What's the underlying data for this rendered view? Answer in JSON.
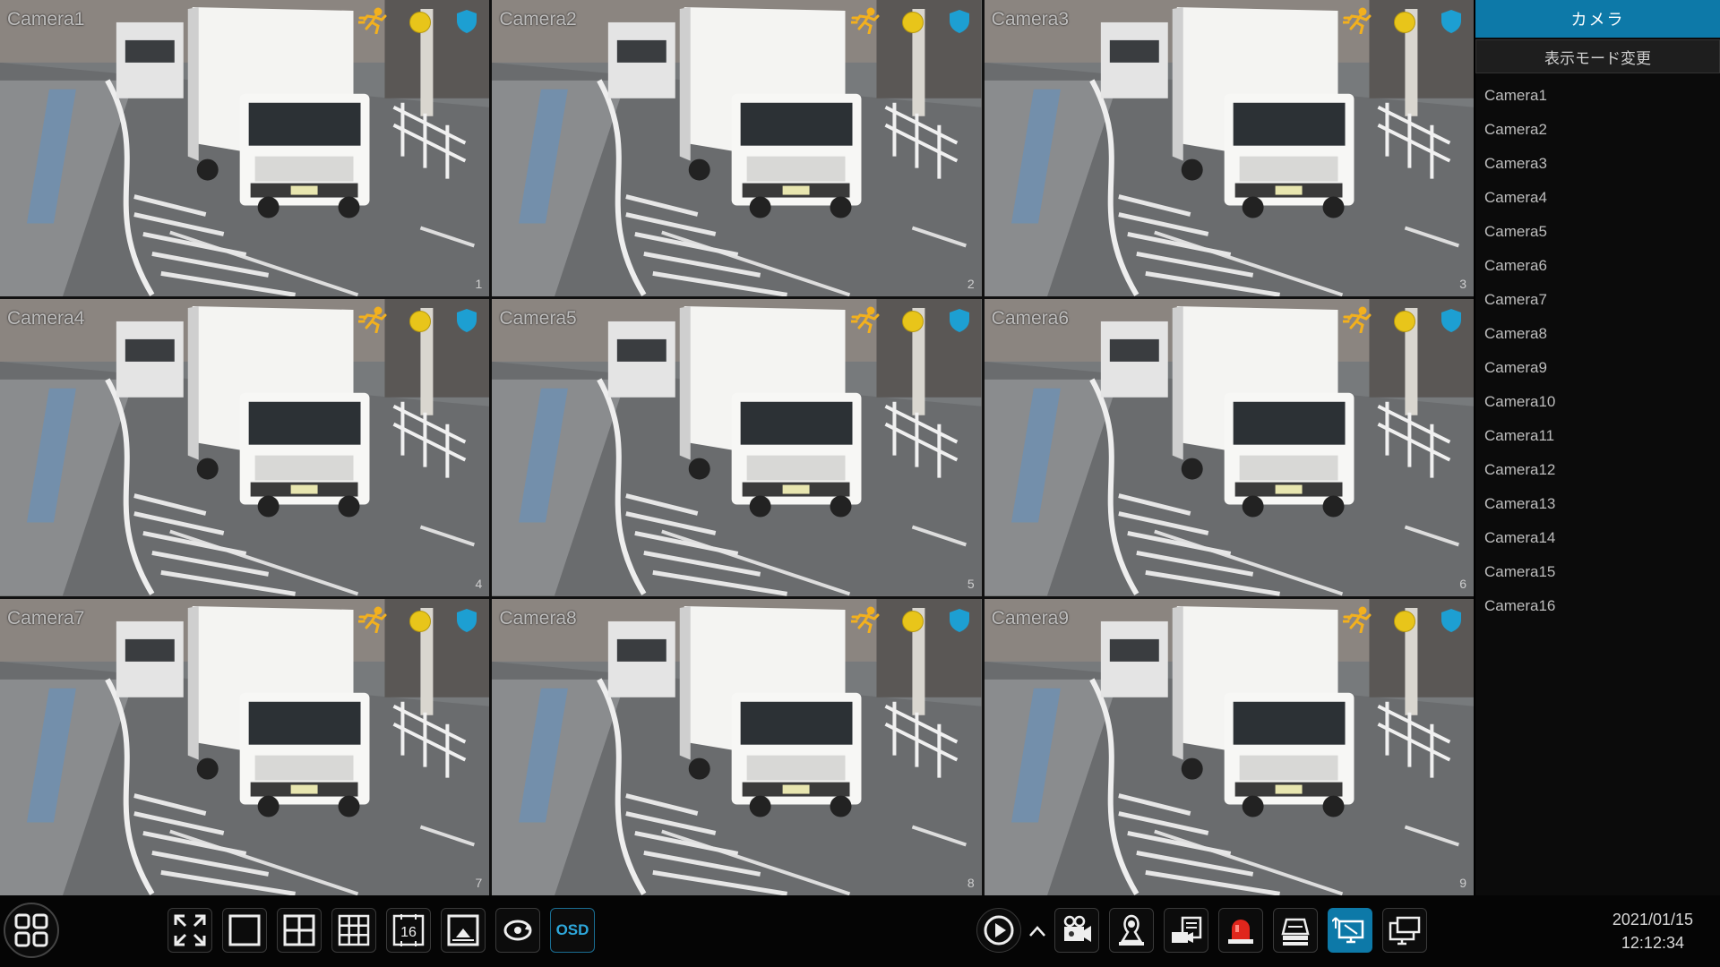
{
  "panel": {
    "header": "カメラ",
    "mode_button": "表示モード変更",
    "cameras": [
      "Camera1",
      "Camera2",
      "Camera3",
      "Camera4",
      "Camera5",
      "Camera6",
      "Camera7",
      "Camera8",
      "Camera9",
      "Camera10",
      "Camera11",
      "Camera12",
      "Camera13",
      "Camera14",
      "Camera15",
      "Camera16"
    ]
  },
  "tiles": [
    {
      "label": "Camera1",
      "number": "1"
    },
    {
      "label": "Camera2",
      "number": "2"
    },
    {
      "label": "Camera3",
      "number": "3"
    },
    {
      "label": "Camera4",
      "number": "4"
    },
    {
      "label": "Camera5",
      "number": "5"
    },
    {
      "label": "Camera6",
      "number": "6"
    },
    {
      "label": "Camera7",
      "number": "7"
    },
    {
      "label": "Camera8",
      "number": "8"
    },
    {
      "label": "Camera9",
      "number": "9"
    }
  ],
  "toolbar": {
    "osd_label": "OSD",
    "layout16_label": "16",
    "buttons": [
      "menu-icon",
      "fullscreen-icon",
      "layout-1-icon",
      "layout-4-icon",
      "layout-9-icon",
      "layout-16-icon",
      "pip-icon",
      "sequence-icon",
      "osd",
      "playback-icon",
      "expand-up-icon",
      "manual-record-icon",
      "ptz-icon",
      "snapshot-icon",
      "alarm-icon",
      "disk-icon",
      "network-icon",
      "monitor-icon"
    ],
    "active_button": "network-icon"
  },
  "clock": {
    "date": "2021/01/15",
    "time": "12:12:34"
  },
  "colors": {
    "accent": "#0d79a8",
    "alarm": "#e8c51a",
    "motion": "#f2b01e"
  }
}
